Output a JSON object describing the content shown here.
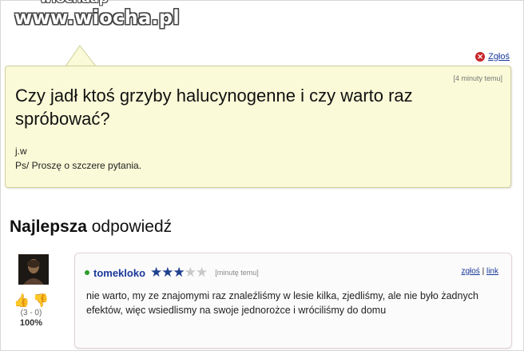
{
  "watermark": {
    "top": "wiochaap",
    "main": "www.wiocha.pl"
  },
  "question": {
    "report_label": "Zgłoś",
    "time": "[4 minuty temu]",
    "title": "Czy jadł ktoś grzyby halucynogenne i czy warto raz spróbować?",
    "body_line1": "j.w",
    "body_line2": "Ps/ Proszę o szczere pytania."
  },
  "best_answer": {
    "heading_bold": "Najlepsza",
    "heading_rest": " odpowiedź"
  },
  "answer": {
    "username": "tomekloko",
    "rating": 3,
    "rating_max": 5,
    "time": "[minutę temu]",
    "report_label": "zgłoś",
    "separator": "|",
    "link_label": "link",
    "body": "nie warto, my ze znajomymi raz znaleźliśmy w lesie kilka, zjedliśmy, ale nie było żadnych efektów, więc wsiedlismy na swoje jednorożce i wróciliśmy do domu",
    "votes": "(3 - 0)",
    "percent": "100%"
  },
  "icons": {
    "report": "close-circle-icon",
    "thumbs_up": "thumbs-up-icon",
    "thumbs_down": "thumbs-down-icon",
    "star": "star-icon"
  },
  "colors": {
    "question_bg": "#fafad8",
    "link": "#1a3a9a",
    "star_on": "#1f3f8f",
    "report": "#c8262b"
  }
}
